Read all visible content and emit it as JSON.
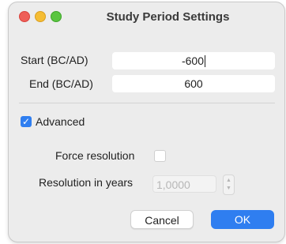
{
  "window": {
    "title": "Study Period Settings"
  },
  "fields": {
    "start": {
      "label": "Start (BC/AD)",
      "value": "-600"
    },
    "end": {
      "label": "End (BC/AD)",
      "value": "600"
    }
  },
  "advanced": {
    "label": "Advanced",
    "checked": true
  },
  "force_resolution": {
    "label": "Force resolution",
    "checked": false
  },
  "resolution": {
    "label": "Resolution in years",
    "placeholder": "1,0000"
  },
  "buttons": {
    "cancel": "Cancel",
    "ok": "OK"
  },
  "colors": {
    "accent": "#2f7ef0",
    "close": "#ee5e57",
    "minimize": "#f5bd34",
    "zoom": "#5ac540"
  }
}
